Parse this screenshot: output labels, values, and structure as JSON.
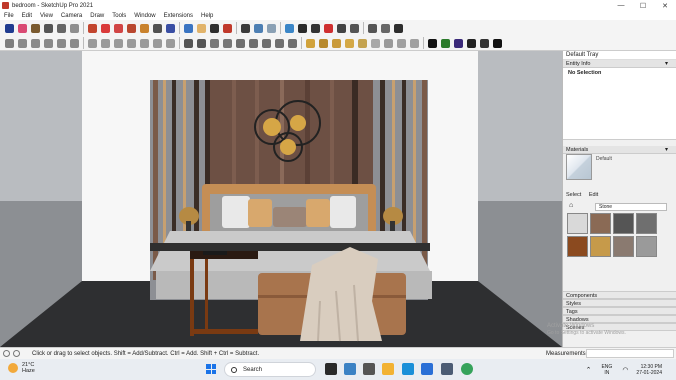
{
  "window": {
    "title": "bedroom - SketchUp Pro 2021",
    "min": "—",
    "max": "☐",
    "close": "✕"
  },
  "menu": [
    "File",
    "Edit",
    "View",
    "Camera",
    "Draw",
    "Tools",
    "Window",
    "Extensions",
    "Help"
  ],
  "toolbar1": [
    {
      "name": "select-tool-icon",
      "color": "#1f3b8f"
    },
    {
      "name": "eraser-tool-icon",
      "color": "#d94a73"
    },
    {
      "name": "pencil-tool-icon",
      "color": "#7a5a2f"
    },
    {
      "name": "freehand-tool-icon",
      "color": "#555555"
    },
    {
      "name": "rectangle-tool-icon",
      "color": "#666666"
    },
    {
      "name": "circle-tool-icon",
      "color": "#8e8e8e"
    },
    {
      "name": "push-pull-tool-icon",
      "color": "#c2452e"
    },
    {
      "name": "move-tool-icon",
      "color": "#d93a3a"
    },
    {
      "name": "rotate-tool-icon",
      "color": "#d14545"
    },
    {
      "name": "offset-tool-icon",
      "color": "#b9472f"
    },
    {
      "name": "paint-bucket-icon",
      "color": "#c9822d"
    },
    {
      "name": "tape-measure-icon",
      "color": "#505050"
    },
    {
      "name": "text-tool-icon",
      "color": "#394ea3"
    },
    {
      "name": "orbit-tool-icon",
      "color": "#3a74c2"
    },
    {
      "name": "pan-tool-icon",
      "color": "#e1b36a"
    },
    {
      "name": "zoom-tool-icon",
      "color": "#2f2f2f"
    },
    {
      "name": "zoom-extents-icon",
      "color": "#c0392b"
    },
    {
      "name": "shape-bender-icon",
      "color": "#3b3b3b"
    },
    {
      "name": "warehouse-icon",
      "color": "#4d7fb3"
    },
    {
      "name": "extension-icon",
      "color": "#8aa0b4"
    },
    {
      "name": "styles-icon",
      "color": "#3b86c7"
    },
    {
      "name": "shadow-icon",
      "color": "#2a2a2a"
    },
    {
      "name": "fog-icon",
      "color": "#333333"
    },
    {
      "name": "section-plane-icon",
      "color": "#cf2f2f"
    },
    {
      "name": "tag-icon",
      "color": "#444444"
    },
    {
      "name": "scene-icon",
      "color": "#555555"
    },
    {
      "name": "camera-icon",
      "color": "#555555"
    },
    {
      "name": "walk-icon",
      "color": "#666666"
    },
    {
      "name": "look-around-icon",
      "color": "#2d2d2d"
    }
  ],
  "toolbar2": [
    {
      "name": "iso-view-icon",
      "color": "#7e7e7e"
    },
    {
      "name": "top-view-icon",
      "color": "#8a8a8a"
    },
    {
      "name": "front-view-icon",
      "color": "#8a8a8a"
    },
    {
      "name": "right-view-icon",
      "color": "#8a8a8a"
    },
    {
      "name": "back-view-icon",
      "color": "#8a8a8a"
    },
    {
      "name": "left-view-icon",
      "color": "#8a8a8a"
    },
    {
      "name": "xray-icon",
      "color": "#9a9a9a"
    },
    {
      "name": "back-edges-icon",
      "color": "#9a9a9a"
    },
    {
      "name": "wireframe-icon",
      "color": "#9a9a9a"
    },
    {
      "name": "hidden-line-icon",
      "color": "#9a9a9a"
    },
    {
      "name": "shaded-icon",
      "color": "#9a9a9a"
    },
    {
      "name": "shaded-textures-icon",
      "color": "#9a9a9a"
    },
    {
      "name": "monochrome-icon",
      "color": "#9a9a9a"
    },
    {
      "name": "make-component-icon",
      "color": "#555555"
    },
    {
      "name": "group-icon",
      "color": "#555555"
    },
    {
      "name": "lock-icon",
      "color": "#777777"
    },
    {
      "name": "outer-shell-icon",
      "color": "#777777"
    },
    {
      "name": "intersect-icon",
      "color": "#6e6e6e"
    },
    {
      "name": "union-icon",
      "color": "#6e6e6e"
    },
    {
      "name": "subtract-icon",
      "color": "#6e6e6e"
    },
    {
      "name": "trim-icon",
      "color": "#6e6e6e"
    },
    {
      "name": "split-icon",
      "color": "#6e6e6e"
    },
    {
      "name": "follow-me-icon",
      "color": "#d1a23b"
    },
    {
      "name": "sandbox-icon",
      "color": "#b88a2e"
    },
    {
      "name": "smoove-icon",
      "color": "#c99a3a"
    },
    {
      "name": "stamp-icon",
      "color": "#d4a845"
    },
    {
      "name": "drape-icon",
      "color": "#c4a350"
    },
    {
      "name": "flip-edge-icon",
      "color": "#a8a8a8"
    },
    {
      "name": "add-location-icon",
      "color": "#9a9a9a"
    },
    {
      "name": "toggle-terrain-icon",
      "color": "#a0a0a0"
    },
    {
      "name": "photo-texture-icon",
      "color": "#a0a0a0"
    },
    {
      "name": "add-icon",
      "color": "#111111"
    },
    {
      "name": "upload-icon",
      "color": "#2a7a2a"
    },
    {
      "name": "dynamic-component-icon",
      "color": "#3b2a7a"
    },
    {
      "name": "checker-icon",
      "color": "#222222"
    },
    {
      "name": "mail-icon",
      "color": "#333333"
    },
    {
      "name": "user-icon",
      "color": "#111111"
    }
  ],
  "tray": {
    "title": "Default Tray",
    "entity_info": "Entity Info",
    "no_selection": "No Selection",
    "materials": "Materials",
    "material_name": "Default",
    "tab_select": "Select",
    "tab_edit": "Edit",
    "collection": "Stone",
    "swatches": [
      "#d9d9d9",
      "#8a6a55",
      "#555555",
      "#6f6f6f",
      "#8b4a1f",
      "#c69a4a",
      "#8a7a70",
      "#9a9a9a"
    ],
    "collapsed": [
      "Components",
      "Styles",
      "Tags",
      "Shadows",
      "Scenes"
    ]
  },
  "status": {
    "hint": "Click or drag to select objects. Shift = Add/Subtract. Ctrl = Add. Shift + Ctrl = Subtract.",
    "measurements": "Measurements"
  },
  "watermark": {
    "line1": "Activate Windows",
    "line2": "Go to Settings to activate Windows."
  },
  "taskbar": {
    "temp": "21°C",
    "weather": "Haze",
    "search": "Search",
    "lang1": "ENG",
    "lang2": "IN",
    "time": "12:30 PM",
    "date": "27-01-2024"
  }
}
